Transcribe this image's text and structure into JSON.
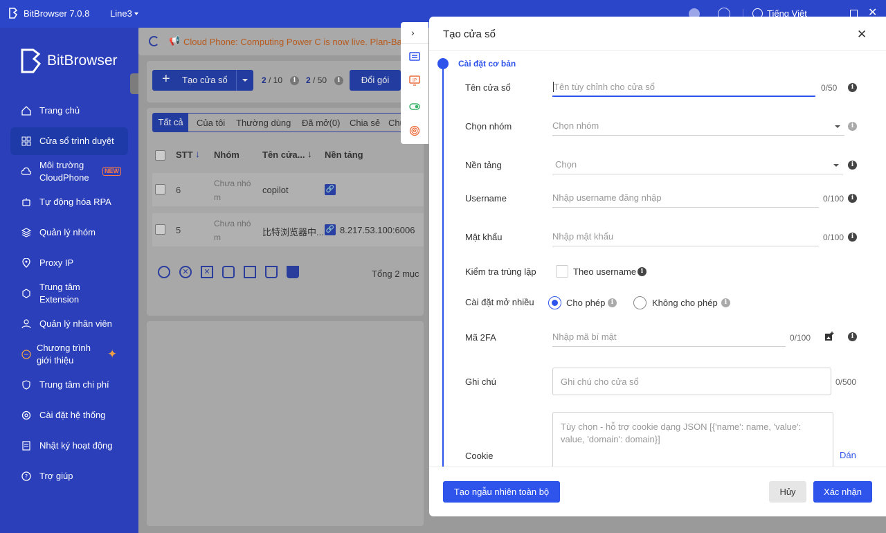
{
  "topbar": {
    "app_title": "BitBrowser 7.0.8",
    "line": "Line3",
    "language": "Tiếng Việt"
  },
  "sidebar": {
    "brand": "BitBrowser",
    "items": [
      {
        "label": "Trang chủ",
        "icon": "home-icon"
      },
      {
        "label": "Cửa sổ trình duyệt",
        "icon": "grid-icon",
        "active": true
      },
      {
        "label": "Môi trường CloudPhone",
        "icon": "cloud-phone-icon",
        "badge": "NEW"
      },
      {
        "label": "Tự động hóa RPA",
        "icon": "robot-icon"
      },
      {
        "label": "Quản lý nhóm",
        "icon": "layers-icon"
      },
      {
        "label": "Proxy IP",
        "icon": "location-icon"
      },
      {
        "label": "Trung tâm Extension",
        "icon": "cube-icon"
      },
      {
        "label": "Quản lý nhân viên",
        "icon": "user-icon"
      },
      {
        "label": "Chương trình giới thiệu",
        "icon": "referral-icon"
      },
      {
        "label": "Trung tâm chi phí",
        "icon": "shield-icon"
      },
      {
        "label": "Cài đặt hệ thống",
        "icon": "settings-icon"
      },
      {
        "label": "Nhật ký hoạt động",
        "icon": "log-icon"
      },
      {
        "label": "Trợ giúp",
        "icon": "help-icon"
      }
    ]
  },
  "main": {
    "announcement": "Cloud Phone: Computing Power C is now live. Plan-Bas",
    "create_button": "Tạo cửa sổ",
    "count1_a": "2",
    "count1_b": "/ 10",
    "count2_a": "2",
    "count2_b": "/ 50",
    "upgrade_button": "Đổi gói",
    "tabs": [
      "Tất cả",
      "Của tôi",
      "Thường dùng",
      "Đã mở(0)",
      "Chia sẻ",
      "Chu"
    ],
    "columns": [
      "STT",
      "Nhóm",
      "Tên cửa...",
      "Nền tảng"
    ],
    "rows": [
      {
        "stt": "6",
        "group_l1": "Chưa nhó",
        "group_l2": "m",
        "name": "copilot",
        "platform": ""
      },
      {
        "stt": "5",
        "group_l1": "Chưa nhó",
        "group_l2": "m",
        "name": "比特浏览器中...",
        "platform": "8.217.53.100:6006"
      }
    ],
    "total": "Tổng 2 mục"
  },
  "modal": {
    "title": "Tạo cửa sổ",
    "section": "Cài đặt cơ bản",
    "fields": {
      "window_name": {
        "label": "Tên cửa sổ",
        "placeholder": "Tên tùy chỉnh cho cửa sổ",
        "count": "0/50"
      },
      "group": {
        "label": "Chọn nhóm",
        "placeholder": "Chọn nhóm"
      },
      "platform": {
        "label": "Nền tảng",
        "placeholder": "Chọn"
      },
      "username": {
        "label": "Username",
        "placeholder": "Nhập username đăng nhập",
        "count": "0/100"
      },
      "password": {
        "label": "Mật khẩu",
        "placeholder": "Nhập mật khẩu",
        "count": "0/100"
      },
      "duplicate": {
        "label": "Kiểm tra trùng lặp",
        "option": "Theo username"
      },
      "multi_open": {
        "label": "Cài đặt mở nhiều",
        "allow": "Cho phép",
        "deny": "Không cho phép"
      },
      "twofa": {
        "label": "Mã 2FA",
        "placeholder": "Nhập mã bí mật",
        "count": "0/100"
      },
      "note": {
        "label": "Ghi chú",
        "placeholder": "Ghi chú cho cửa sổ",
        "count": "0/500"
      },
      "cookie": {
        "label": "Cookie",
        "placeholder": "Tùy chọn - hỗ trợ cookie dạng JSON [{'name': name, 'value': value, 'domain': domain}]",
        "paste": "Dán"
      }
    },
    "random_all_button": "Tạo ngẫu nhiên toàn bộ",
    "cancel_button": "Hủy",
    "confirm_button": "Xác nhận"
  },
  "colors": {
    "primary": "#2f54eb",
    "sidebar": "#2a3fb9",
    "topbar": "#2b46c9",
    "announcement": "#e8742b"
  }
}
